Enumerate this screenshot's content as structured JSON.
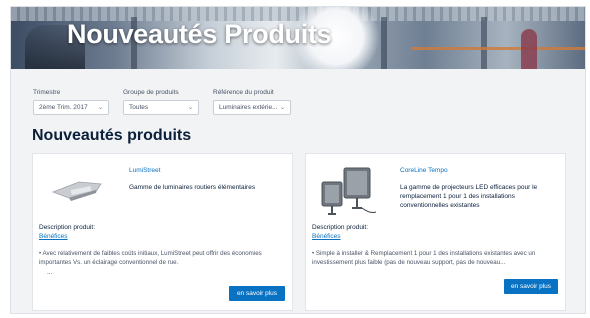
{
  "hero": {
    "title": "Nouveautés Produits"
  },
  "filters": [
    {
      "label": "Trimestre",
      "value": "2ème Trim. 2017"
    },
    {
      "label": "Groupe de produits",
      "value": "Toutes"
    },
    {
      "label": "Référence du produit",
      "value": "Luminaires extérie..."
    }
  ],
  "section": {
    "title": "Nouveautés produits"
  },
  "cards": [
    {
      "product_name": "LumiStreet",
      "product_tagline": "Gamme de luminaires routiers élémentaires",
      "description_label": "Description produit:",
      "benefits_link": "Bénéfices",
      "bullet": "•  Avec relativement de faibles coûts initiaux, LumiStreet peut offrir des économies importantes Vs. un éclairage conventionnel de rue.",
      "ellipsis": "...",
      "button": "en savoir plus"
    },
    {
      "product_name": "CoreLine Tempo",
      "product_tagline": "La gamme de projecteurs LED efficaces pour le remplacement 1 pour 1 des installations conventionnelles existantes",
      "description_label": "Description produit:",
      "benefits_link": "Bénéfices",
      "bullet": "•  Simple à installer & Remplacement 1 pour 1 des installations existantes avec un investissement plus faible (pas de nouveau support, pas de nouveau...",
      "button": "en savoir plus"
    }
  ],
  "colors": {
    "accent": "#0a72c3",
    "title": "#0b1f3a",
    "background": "#f1f3f5"
  },
  "icons": {
    "chevron": "chevron-down-icon"
  }
}
